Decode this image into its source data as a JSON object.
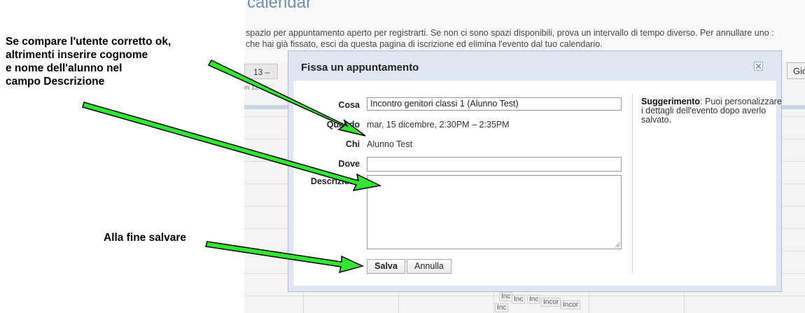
{
  "background": {
    "title": "calendar",
    "line1": "spazio per appuntamento aperto per registrarti. Se non ci sono spazi disponibili, prova un intervallo di tempo diverso. Per annullare uno :",
    "line2": "che hai già fissato, esci da questa pagina di iscrizione ed elimina l'evento dal tuo calendario.",
    "week_label": "13 –",
    "gio_label": "Gio",
    "time_label": "m 12",
    "event_chips": [
      "Inc",
      "Inc",
      "Inc",
      "Incor",
      "Incor",
      "Inc"
    ]
  },
  "annotations": {
    "top": [
      "Se compare l'utente corretto ok,",
      "altrimenti inserire cognome",
      "e nome dell'alunno nel",
      "campo Descrizione"
    ],
    "bottom": "Alla fine salvare"
  },
  "dialog": {
    "title": "Fissa un appuntamento",
    "close_icon": "close-icon",
    "fields": {
      "cosa_label": "Cosa",
      "cosa_value": "Incontro genitori classi 1 (Alunno Test)",
      "quando_label": "Quando",
      "quando_value": "mar, 15 dicembre, 2:30PM – 2:35PM",
      "chi_label": "Chi",
      "chi_value": "Alunno Test",
      "dove_label": "Dove",
      "dove_value": "",
      "descrizione_label": "Descrizione",
      "descrizione_value": ""
    },
    "buttons": {
      "save": "Salva",
      "cancel": "Annulla"
    },
    "tip": {
      "bold": "Suggerimento",
      "text": ": Puoi personalizzare i dettagli dell'evento dopo averlo salvato."
    }
  },
  "colors": {
    "arrow_fill": "#33e533",
    "arrow_stroke": "#000000",
    "dialog_frame": "#dfe6f2",
    "title_blue": "#6d8fb8"
  }
}
